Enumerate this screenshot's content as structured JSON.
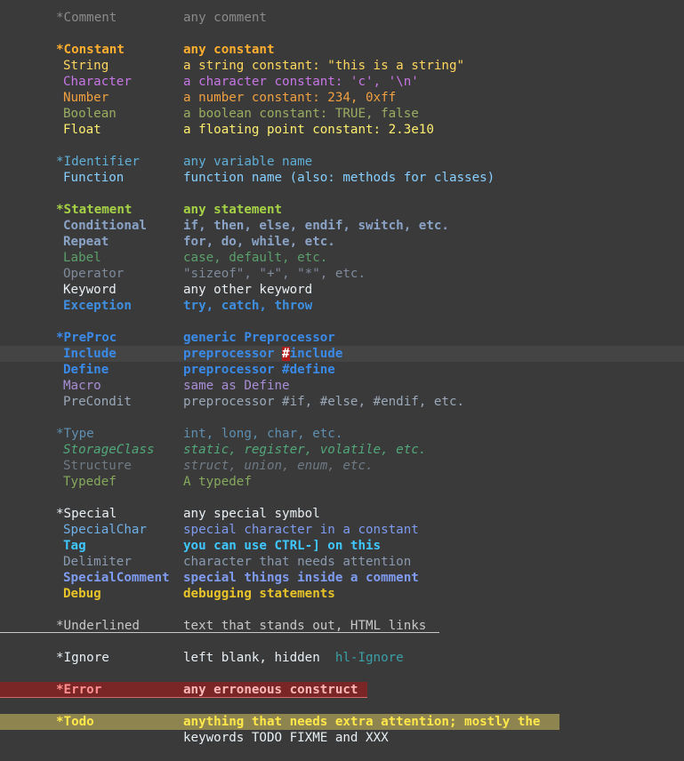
{
  "groups": {
    "comment": {
      "name": "*Comment",
      "desc": "any comment"
    },
    "constant": {
      "name": "*Constant",
      "desc": "any constant"
    },
    "string": {
      "name": "String",
      "desc": "a string constant: \"this is a string\""
    },
    "character": {
      "name": "Character",
      "desc": "a character constant: 'c', '\\n'"
    },
    "number": {
      "name": "Number",
      "desc": "a number constant: 234, 0xff"
    },
    "boolean": {
      "name": "Boolean",
      "desc": "a boolean constant: TRUE, false"
    },
    "float": {
      "name": "Float",
      "desc": "a floating point constant: 2.3e10"
    },
    "identifier": {
      "name": "*Identifier",
      "desc": "any variable name"
    },
    "function": {
      "name": "Function",
      "desc": "function name (also: methods for classes)"
    },
    "statement": {
      "name": "*Statement",
      "desc": "any statement"
    },
    "conditional": {
      "name": "Conditional",
      "desc": "if, then, else, endif, switch, etc."
    },
    "repeat": {
      "name": "Repeat",
      "desc": "for, do, while, etc."
    },
    "label": {
      "name": "Label",
      "desc": "case, default, etc."
    },
    "operator": {
      "name": "Operator",
      "desc": "\"sizeof\", \"+\", \"*\", etc."
    },
    "keyword": {
      "name": "Keyword",
      "desc": "any other keyword"
    },
    "exception": {
      "name": "Exception",
      "desc": "try, catch, throw"
    },
    "preproc": {
      "name": "*PreProc",
      "desc": "generic Preprocessor"
    },
    "include": {
      "name": "Include",
      "desc_before": "preprocessor ",
      "desc_cursor": "#",
      "desc_after": "include"
    },
    "define": {
      "name": "Define",
      "desc": "preprocessor #define"
    },
    "macro": {
      "name": "Macro",
      "desc": "same as Define"
    },
    "precondit": {
      "name": "PreCondit",
      "desc": "preprocessor #if, #else, #endif, etc."
    },
    "type": {
      "name": "*Type",
      "desc": "int, long, char, etc."
    },
    "storageclass": {
      "name": "StorageClass",
      "desc": "static, register, volatile, etc."
    },
    "structure": {
      "name": "Structure",
      "desc": "struct, union, enum, etc."
    },
    "typedef": {
      "name": "Typedef",
      "desc": "A typedef"
    },
    "special": {
      "name": "*Special",
      "desc": "any special symbol"
    },
    "specialchar": {
      "name": "SpecialChar",
      "desc": "special character in a constant"
    },
    "tag": {
      "name": "Tag",
      "desc": "you can use CTRL-] on this"
    },
    "delimiter": {
      "name": "Delimiter",
      "desc": "character that needs attention"
    },
    "specialcomment": {
      "name": "SpecialComment",
      "desc": "special things inside a comment"
    },
    "debug": {
      "name": "Debug",
      "desc": "debugging statements"
    },
    "underlined": {
      "name": "*Underlined",
      "desc": "text that stands out, HTML links"
    },
    "ignore": {
      "name": "*Ignore",
      "desc": "left blank, hidden",
      "extra": "hl-Ignore"
    },
    "error": {
      "name": "*Error",
      "desc": "any erroneous construct"
    },
    "todo": {
      "name": "*Todo",
      "desc": "anything that needs extra attention; mostly the",
      "desc2": "keywords TODO FIXME and XXX"
    }
  },
  "colors": {
    "background": "#3a3a3a",
    "cursorline": "#444444",
    "cursor": "#b31b1b",
    "error_bg": "#7a2626",
    "todo_bg": "#8d8450"
  }
}
